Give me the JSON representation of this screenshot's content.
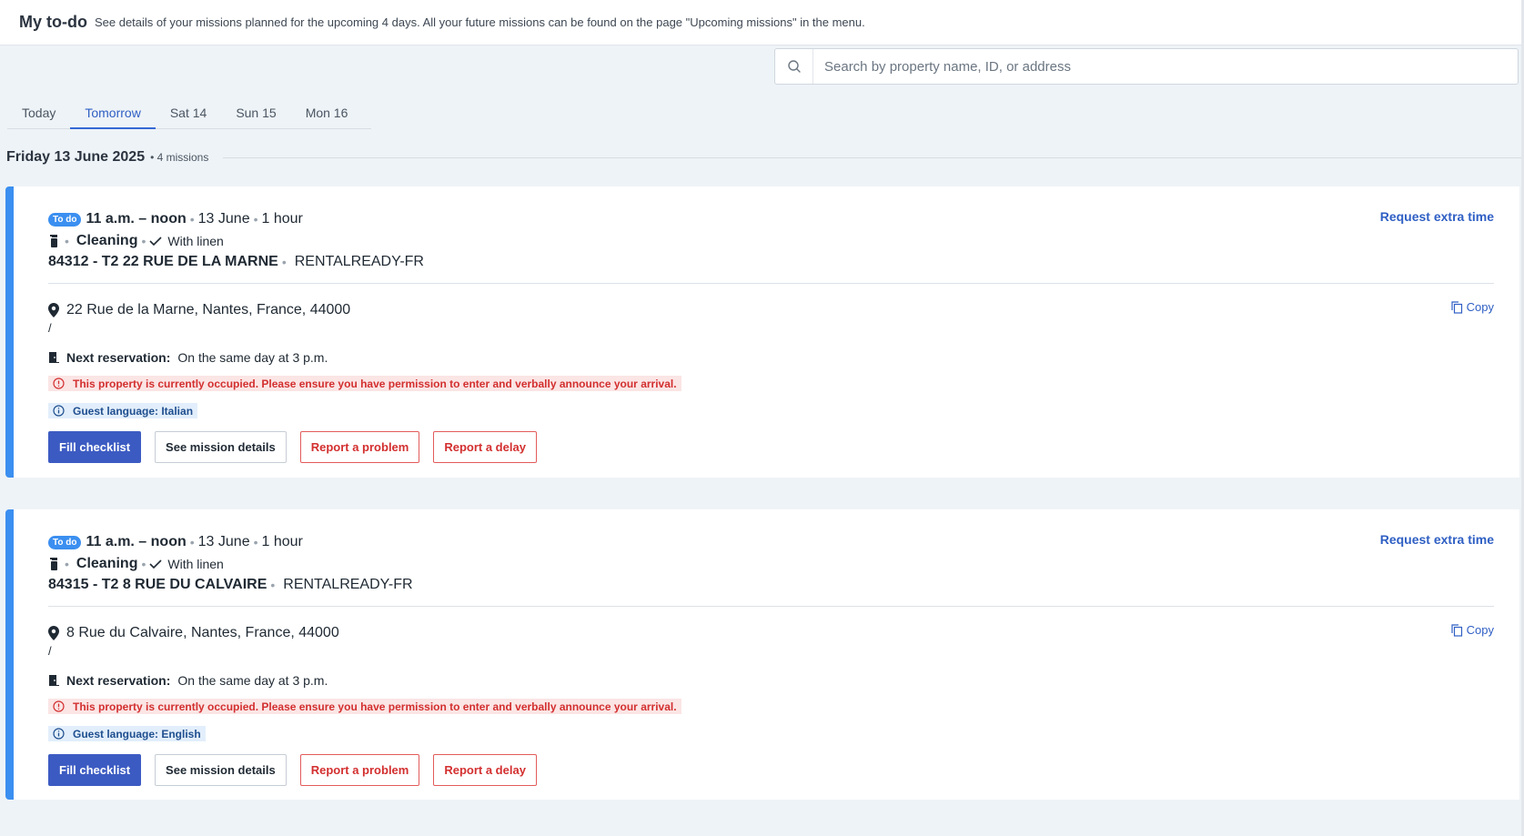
{
  "header": {
    "title": "My to-do",
    "subtitle": "See details of your missions planned for the upcoming 4 days. All your future missions can be found on the page \"Upcoming missions\" in the menu."
  },
  "search": {
    "placeholder": "Search by property name, ID, or address",
    "value": ""
  },
  "tabs": [
    {
      "label": "Today",
      "active": false
    },
    {
      "label": "Tomorrow",
      "active": true
    },
    {
      "label": "Sat 14",
      "active": false
    },
    {
      "label": "Sun 15",
      "active": false
    },
    {
      "label": "Mon 16",
      "active": false
    }
  ],
  "day": {
    "title": "Friday 13 June 2025",
    "count": "• 4 missions"
  },
  "colors": {
    "accent": "#3b8ff0",
    "primary_button": "#3c5bc2",
    "danger": "#d32f2f",
    "link": "#2f5fc4"
  },
  "missions": [
    {
      "status": "To do",
      "time": "11 a.m. – noon",
      "date": "13 June",
      "duration": "1 hour",
      "type": "Cleaning",
      "linen": "With linen",
      "property_name": "84312 - T2 22 RUE DE LA MARNE",
      "organization": "RENTALREADY-FR",
      "request_time": "Request extra time",
      "address": "22 Rue de la Marne, Nantes, France, 44000",
      "address_extra": "/",
      "copy": "Copy",
      "next_label": "Next reservation:",
      "next_value": "On the same day at 3 p.m.",
      "warning": "This property is currently occupied. Please ensure you have permission to enter and verbally announce your arrival.",
      "language": "Guest language: Italian",
      "actions": {
        "fill": "Fill checklist",
        "details": "See mission details",
        "problem": "Report a problem",
        "delay": "Report a delay"
      }
    },
    {
      "status": "To do",
      "time": "11 a.m. – noon",
      "date": "13 June",
      "duration": "1 hour",
      "type": "Cleaning",
      "linen": "With linen",
      "property_name": "84315 - T2 8 RUE DU CALVAIRE",
      "organization": "RENTALREADY-FR",
      "request_time": "Request extra time",
      "address": "8 Rue du Calvaire, Nantes, France, 44000",
      "address_extra": "/",
      "copy": "Copy",
      "next_label": "Next reservation:",
      "next_value": "On the same day at 3 p.m.",
      "warning": "This property is currently occupied. Please ensure you have permission to enter and verbally announce your arrival.",
      "language": "Guest language: English",
      "actions": {
        "fill": "Fill checklist",
        "details": "See mission details",
        "problem": "Report a problem",
        "delay": "Report a delay"
      }
    }
  ]
}
